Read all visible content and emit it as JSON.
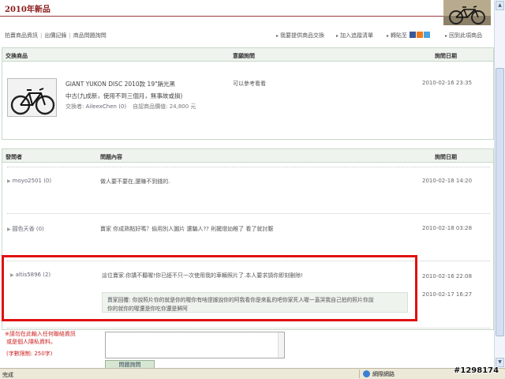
{
  "header": {
    "title": "2010年新品"
  },
  "nav": {
    "links": [
      "拍賣商品資訊",
      "出價記錄",
      "商品問題詢問"
    ],
    "right": {
      "provide_exchange": "我要提供商品交換",
      "add_tracking": "加入追蹤清單",
      "forward": "轉貼至",
      "back": "回到此項商品"
    }
  },
  "exchange_table": {
    "headers": {
      "item": "交換商品",
      "intent": "意願詢問",
      "date": "詢問日期"
    },
    "row": {
      "product_name": "GIANT YUKON DISC 2010款 19\"銷光黑",
      "condition": "中古(九成新，使用不到三個月，無事故或損)",
      "exchanger_label": "交換者:",
      "exchanger": "AileexChen (0)",
      "price_label": "自認商品價值:",
      "price": "24,800 元",
      "intent": "可以參考看看",
      "date": "2010-02-16 23:35"
    }
  },
  "qa_table": {
    "headers": {
      "asker": "發問者",
      "content": "問題內容",
      "date": "詢問日期"
    },
    "rows": [
      {
        "user": "moyo2501 (0)",
        "question": "做人要不要在,還賺不到錢的.",
        "date": "2010-02-18 14:20"
      },
      {
        "user": "圓色天香 (0)",
        "question": "賣家 你成熟點好嗎？偷用別人圖片 還騙人?? 則擺燈幼稚了 看了就討厭",
        "date": "2010-02-18 03:28"
      },
      {
        "user": "altis5896 (2)",
        "question": "這位賣家.你講不聽喔!你已經不只一次使用我的車輛照片了.本人要求請你即刻刪除!",
        "date": "2010-02-16 22:08"
      }
    ],
    "reply": {
      "line1": "賣家回覆: 你說照片你的就是你的喔你有啥證據說你的阿我看你是來亂的吧你家死人喔一直哭我自己拍的照片你說",
      "line2": "你的就你的喔還是你吃你還是鮮阿",
      "date": "2010-02-17 16:27"
    }
  },
  "form": {
    "warning_line1": "※請勿在此輸入任何聯絡資訊",
    "warning_line2": "或是個人隱私資料。",
    "limit": "(字數限制: 250字)",
    "submit": "問題詢問"
  },
  "status_bar": {
    "left": "完成",
    "zone": "網際網路"
  },
  "watermark": "#1298174",
  "colors": {
    "title": "#8a1a1a",
    "warning": "#cc2222",
    "highlight_box": "#e01111",
    "panel_header": "#eef3ee"
  }
}
